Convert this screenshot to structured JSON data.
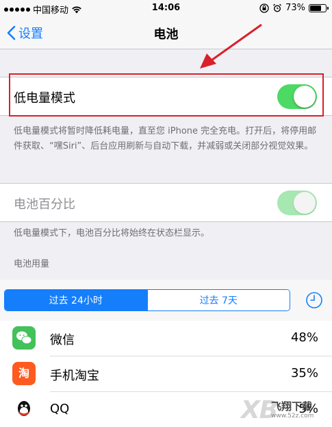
{
  "status_bar": {
    "carrier": "中国移动",
    "time": "14:06",
    "battery_percent": "73%",
    "battery_level": 0.73
  },
  "nav": {
    "back_label": "设置",
    "title": "电池"
  },
  "low_power": {
    "label": "低电量模式",
    "enabled": true,
    "footnote": "低电量模式将暂时降低耗电量，直至您 iPhone 完全充电。打开后，将停用邮件获取、“嘿Siri”、后台应用刷新与自动下载，并减弱或关闭部分视觉效果。"
  },
  "battery_percentage": {
    "label": "电池百分比",
    "enabled": true,
    "dimmed": true,
    "footnote": "低电量模式下，电池百分比将始终在状态栏显示。"
  },
  "usage": {
    "header": "电池用量",
    "segments": [
      "过去 24小时",
      "过去 7天"
    ],
    "selected_segment": 0,
    "apps": [
      {
        "name": "微信",
        "percent": "48%",
        "icon": "wechat-icon",
        "color": "#43c15a"
      },
      {
        "name": "手机淘宝",
        "percent": "35%",
        "icon": "taobao-icon",
        "color": "#ff5a1f"
      },
      {
        "name": "QQ",
        "percent": "5%",
        "icon": "qq-icon",
        "color": "#111111"
      }
    ]
  },
  "watermark": {
    "big": "XB",
    "name": "飞翔下载",
    "url": "www.52z.com"
  },
  "colors": {
    "ios_blue": "#157efb",
    "toggle_green": "#4cd964",
    "annotation_red": "#d9202a"
  }
}
